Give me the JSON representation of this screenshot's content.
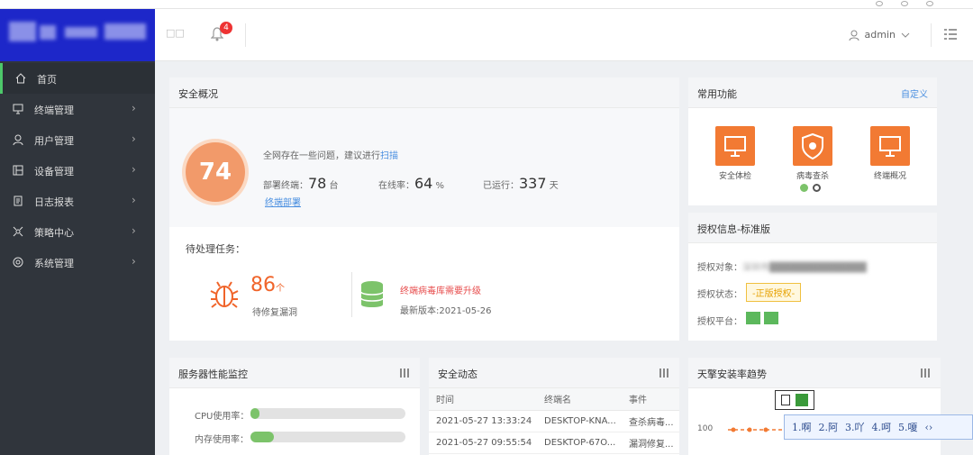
{
  "header": {
    "left_label": "□□",
    "bell_badge": "4",
    "username": "admin"
  },
  "sidebar": {
    "items": [
      {
        "label": "首页",
        "icon": "home-icon"
      },
      {
        "label": "终端管理",
        "icon": "monitor-icon"
      },
      {
        "label": "用户管理",
        "icon": "user-icon"
      },
      {
        "label": "设备管理",
        "icon": "device-icon"
      },
      {
        "label": "日志报表",
        "icon": "report-icon"
      },
      {
        "label": "策略中心",
        "icon": "policy-icon"
      },
      {
        "label": "系统管理",
        "icon": "settings-icon"
      }
    ]
  },
  "security": {
    "title": "安全概况",
    "score": "74",
    "notice": "全网存在一些问题，建议进行",
    "notice_link": "扫描",
    "deployed_label": "部署终端：",
    "deployed_value": "78",
    "deployed_unit": "台",
    "online_label": "在线率：",
    "online_value": "64",
    "online_unit": "%",
    "running_label": "已运行：",
    "running_value": "337",
    "running_unit": "天",
    "deploy_link": "终端部署",
    "pending_label": "待处理任务：",
    "vuln_count": "86",
    "vuln_unit": "个",
    "vuln_label": "待修复漏洞",
    "upgrade_label": "终端病毒库需要升级",
    "version_label": "最新版本:2021-05-26"
  },
  "common": {
    "title": "常用功能",
    "customize": "自定义",
    "items": [
      "安全体检",
      "病毒查杀",
      "终端概况"
    ]
  },
  "license": {
    "title": "授权信息-标准版",
    "object_label": "授权对象：",
    "object_value": "深圳市██████████████",
    "status_label": "授权状态：",
    "status_value": "-正版授权-",
    "platform_label": "授权平台："
  },
  "server": {
    "title": "服务器性能监控",
    "cpu_label": "CPU使用率：",
    "cpu_fraction": 0.06,
    "mem_label": "内存使用率：",
    "mem_fraction": 0.15
  },
  "events": {
    "title": "安全动态",
    "columns": [
      "时间",
      "终端名",
      "事件"
    ],
    "rows": [
      [
        "2021-05-27 13:33:24",
        "DESKTOP-KNA...",
        "查杀病毒..."
      ],
      [
        "2021-05-27 09:55:54",
        "DESKTOP-67O...",
        "漏洞修复..."
      ]
    ]
  },
  "trend": {
    "title": "天擎安装率趋势",
    "y_tick": "100"
  },
  "ime": {
    "candidates": [
      "1.啊",
      "2.阿",
      "3.吖",
      "4.呵",
      "5.嗄"
    ]
  },
  "colors": {
    "accent_orange": "#f27a33",
    "sidebar_bg": "#30353c",
    "logo_bg": "#1d27c9",
    "link_blue": "#4a8fe0",
    "active_green": "#4dc86a"
  }
}
